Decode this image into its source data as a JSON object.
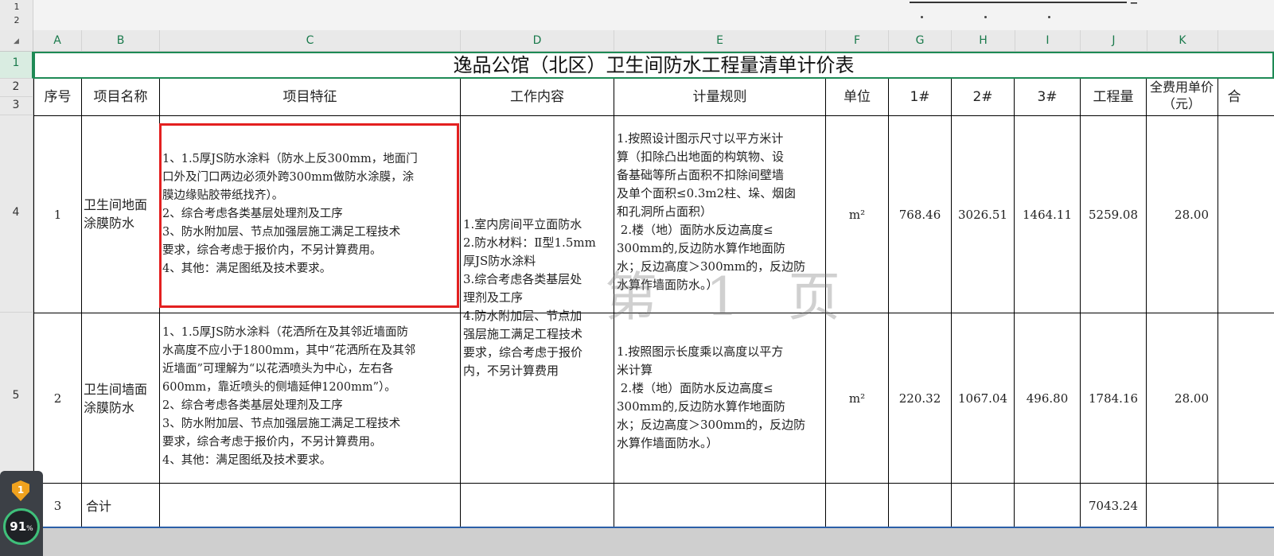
{
  "group_levels": [
    "1",
    "2"
  ],
  "columns": [
    "A",
    "B",
    "C",
    "D",
    "E",
    "F",
    "G",
    "H",
    "I",
    "J",
    "K"
  ],
  "rows": [
    "1",
    "2",
    "3",
    "4",
    "5"
  ],
  "title": "逸品公馆（北区）卫生间防水工程量清单计价表",
  "headers": {
    "seq": "序号",
    "name": "项目名称",
    "feature": "项目特征",
    "work": "工作内容",
    "rule": "计量规则",
    "unit": "单位",
    "b1": "1#",
    "b2": "2#",
    "b3": "3#",
    "qty": "工程量",
    "price": "全费用单价（元）",
    "total": "合"
  },
  "row1": {
    "seq": "1",
    "name": "卫生间地面\n涂膜防水",
    "feature": "1、1.5厚JS防水涂料（防水上反300mm，地面门\n口外及门口两边必须外跨300mm做防水涂膜，涂\n膜边缘贴胶带纸找齐）。\n2、综合考虑各类基层处理剂及工序\n3、防水附加层、节点加强层施工满足工程技术\n要求，综合考虑于报价内，不另计算费用。\n4、其他：满足图纸及技术要求。",
    "rule": "1.按照设计图示尺寸以平方米计\n算（扣除凸出地面的构筑物、设\n备基础等所占面积不扣除间壁墙\n及单个面积≤0.3m2柱、垛、烟囱\n和孔洞所占面积）\n 2.楼（地）面防水反边高度≤\n300mm的,反边防水算作地面防\n水；反边高度＞300mm的，反边防\n水算作墙面防水。）",
    "unit": "m²",
    "b1": "768.46",
    "b2": "3026.51",
    "b3": "1464.11",
    "qty": "5259.08",
    "price": "28.00"
  },
  "work_content": "1.室内房间平立面防水\n2.防水材料：Ⅱ型1.5mm\n厚JS防水涂料\n3.综合考虑各类基层处\n理剂及工序\n4.防水附加层、节点加\n强层施工满足工程技术\n要求，综合考虑于报价\n内，不另计算费用",
  "row2": {
    "seq": "2",
    "name": "卫生间墙面\n涂膜防水",
    "feature": "1、1.5厚JS防水涂料（花洒所在及其邻近墙面防\n水高度不应小于1800mm，其中“花洒所在及其邻\n近墙面”可理解为“以花洒喷头为中心，左右各\n600mm，靠近喷头的侧墙延伸1200mm”）。\n2、综合考虑各类基层处理剂及工序\n3、防水附加层、节点加强层施工满足工程技术\n要求，综合考虑于报价内，不另计算费用。\n4、其他：满足图纸及技术要求。",
    "rule": "1.按照图示长度乘以高度以平方\n米计算\n 2.楼（地）面防水反边高度≤\n300mm的,反边防水算作地面防\n水；反边高度＞300mm的，反边防\n水算作墙面防水。）",
    "unit": "m²",
    "b1": "220.32",
    "b2": "1067.04",
    "b3": "496.80",
    "qty": "1784.16",
    "price": "28.00"
  },
  "row3": {
    "seq": "3",
    "name": "合计",
    "qty": "7043.24"
  },
  "watermark": "第 1 页",
  "widget": {
    "badge": "1",
    "score": "91",
    "pct": "%",
    "ring_color": "#3fc07a",
    "shield_color": "#f0a21e"
  },
  "colors": {
    "selection": "#1e8a55",
    "highlight_box": "#e32020"
  }
}
